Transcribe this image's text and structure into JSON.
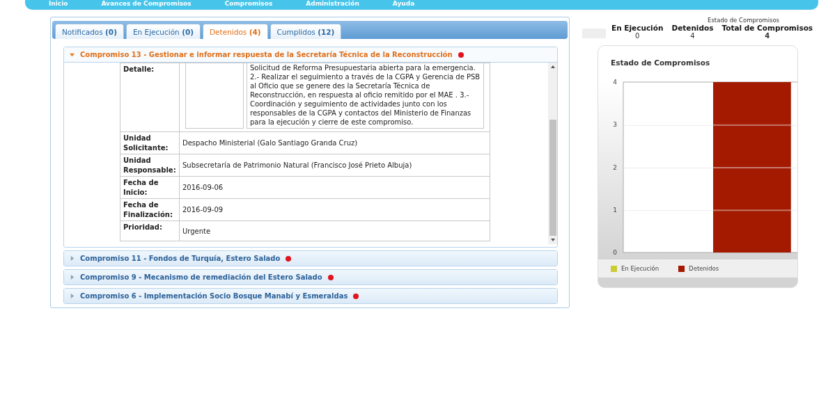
{
  "nav": {
    "items": [
      "Inicio",
      "Avances de Compromisos",
      "Compromisos",
      "Administración",
      "Ayuda"
    ]
  },
  "tabs": [
    {
      "label": "Notificados",
      "count": "(0)",
      "selected": false
    },
    {
      "label": "En Ejecución",
      "count": "(0)",
      "selected": false
    },
    {
      "label": "Detenidos",
      "count": "(4)",
      "selected": true
    },
    {
      "label": "Cumplidos",
      "count": "(12)",
      "selected": false
    }
  ],
  "compromisos": [
    {
      "title": "Compromiso 13 - Gestionar e informar respuesta de la Secretaría Técnica de la Reconstrucción",
      "expanded": true,
      "color": "#e0141e",
      "detalle": {
        "label": "Detalle:",
        "text": "Solicitud de Reforma Presupuestaria abierta para la emergencia. 2.- Realizar el seguimiento a través de la CGPA y Gerencia de PSB al Oficio que se genere des la Secretaría Técnica de Reconstrucción, en respuesta al oficio remitido por el MAE . 3.- Coordinación y seguimiento de actividades junto con los responsables de la CGPA y contactos del Ministerio de Finanzas para la ejecución y cierre de este compromiso."
      },
      "fields": [
        {
          "label": "Unidad Solicitante:",
          "value": "Despacho Ministerial (Galo Santiago Granda Cruz)"
        },
        {
          "label": "Unidad Responsable:",
          "value": "Subsecretaría de Patrimonio Natural (Francisco José Prieto Albuja)"
        },
        {
          "label": "Fecha de Inicio:",
          "value": "2016-09-06"
        },
        {
          "label": "Fecha de Finalización:",
          "value": "2016-09-09"
        },
        {
          "label": "Prioridad:",
          "value": "Urgente"
        }
      ]
    },
    {
      "title": "Compromiso 11 - Fondos de Turquía, Estero Salado",
      "expanded": false,
      "color": "#e0141e"
    },
    {
      "title": "Compromiso 9 - Mecanismo de remediación del Estero Salado",
      "expanded": false,
      "color": "#e0141e"
    },
    {
      "title": "Compromiso 6 - Implementación Socio Bosque Manabí y Esmeraldas",
      "expanded": false,
      "color": "#e0141e"
    }
  ],
  "summary": {
    "caption": "Estado de Compromisos",
    "columns": [
      {
        "label": "En Ejecución",
        "value": "0"
      },
      {
        "label": "Detenidos",
        "value": "4"
      },
      {
        "label": "Total de Compromisos",
        "value": "4"
      }
    ]
  },
  "chart_panel": {
    "chart_data": {
      "type": "bar",
      "grid": true,
      "title": "Estado de Compromisos",
      "ylim": [
        0,
        4
      ],
      "yticks": [
        0,
        1,
        2,
        3,
        4
      ],
      "series": [
        {
          "name": "En Ejecución",
          "color": "#cccc33",
          "values": [
            0
          ]
        },
        {
          "name": "Detenidos",
          "color": "#a31a00",
          "values": [
            4
          ]
        }
      ]
    }
  }
}
